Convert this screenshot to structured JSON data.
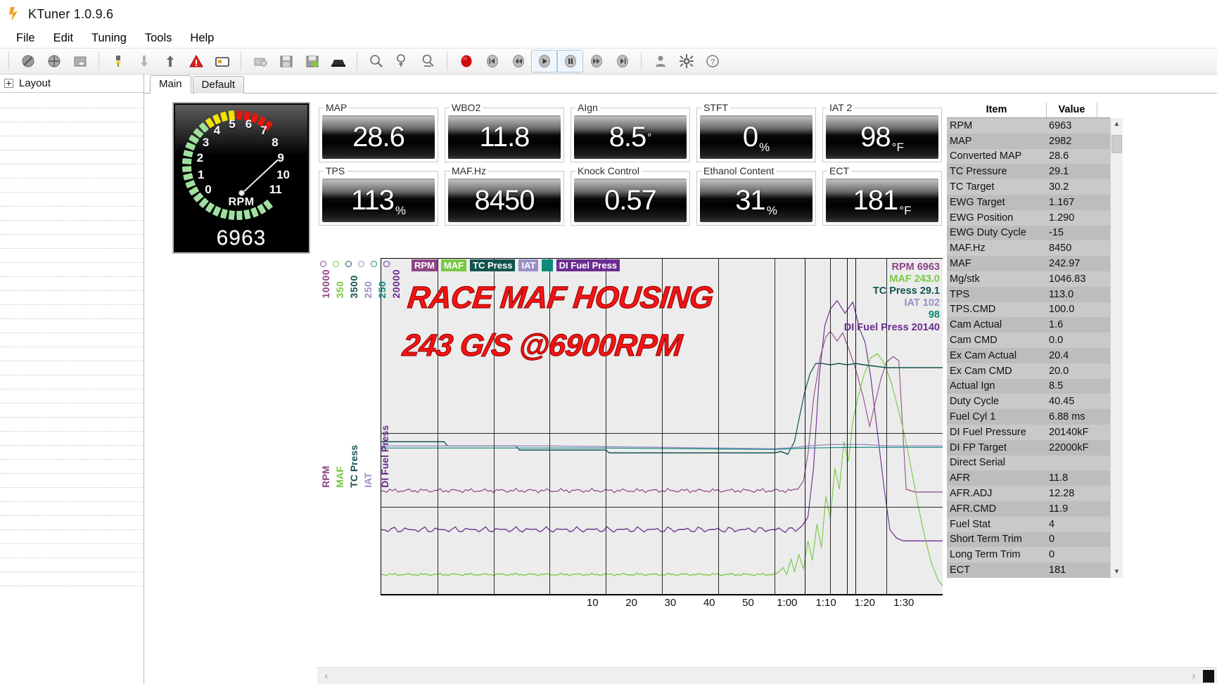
{
  "window": {
    "title": "KTuner 1.0.9.6",
    "logo_icon": "ktuner-logo-icon"
  },
  "menu": {
    "items": [
      "File",
      "Edit",
      "Tuning",
      "Tools",
      "Help"
    ]
  },
  "toolbar": {
    "groups": [
      {
        "buttons": [
          {
            "name": "disconnect-icon",
            "label": "Disconnect"
          },
          {
            "name": "connect-icon",
            "label": "Connect"
          },
          {
            "name": "open-folder-icon",
            "label": "Open"
          }
        ]
      },
      {
        "buttons": [
          {
            "name": "flash-ecu-icon",
            "label": "Flash"
          },
          {
            "name": "download-icon",
            "label": "Read"
          },
          {
            "name": "upload-icon",
            "label": "Write"
          },
          {
            "name": "dtc-warning-icon",
            "label": "Trouble Codes"
          },
          {
            "name": "monitor-icon",
            "label": "Monitor"
          }
        ]
      },
      {
        "buttons": [
          {
            "name": "datalog-icon",
            "label": "Datalog"
          },
          {
            "name": "save-icon",
            "label": "Save"
          },
          {
            "name": "save-as-icon",
            "label": "Save As"
          },
          {
            "name": "export-icon",
            "label": "Export"
          }
        ]
      },
      {
        "buttons": [
          {
            "name": "zoom-icon",
            "label": "Zoom"
          },
          {
            "name": "zoom-in-icon",
            "label": "Zoom In"
          },
          {
            "name": "zoom-out-icon",
            "label": "Zoom Out"
          }
        ]
      },
      {
        "buttons": [
          {
            "name": "record-icon",
            "label": "Record"
          },
          {
            "name": "skip-back-icon",
            "label": "Skip Back"
          },
          {
            "name": "rewind-icon",
            "label": "Rewind"
          },
          {
            "name": "play-icon",
            "label": "Play",
            "active": true
          },
          {
            "name": "pause-icon",
            "label": "Pause",
            "active": true
          },
          {
            "name": "fast-forward-icon",
            "label": "Fast Forward"
          },
          {
            "name": "skip-forward-icon",
            "label": "Skip Forward"
          }
        ]
      },
      {
        "buttons": [
          {
            "name": "user-icon",
            "label": "Account"
          },
          {
            "name": "gear-icon",
            "label": "Settings"
          },
          {
            "name": "help-icon",
            "label": "Help"
          }
        ]
      }
    ]
  },
  "left_panel": {
    "title": "Layout",
    "expander_icon": "plus-expander-icon",
    "row_count": 35
  },
  "tabs": [
    {
      "label": "Main",
      "selected": true
    },
    {
      "label": "Default",
      "selected": false
    }
  ],
  "tachometer": {
    "name": "rpm-tachometer",
    "unit_label": "RPM",
    "readout": "6963",
    "numbers": [
      "0",
      "1",
      "2",
      "3",
      "4",
      "5",
      "6",
      "7",
      "8",
      "9",
      "10",
      "11"
    ],
    "green_color": "#9fe09f",
    "yellow_color": "#f5e200",
    "red_color": "#e8150f"
  },
  "gauges": [
    {
      "label": "MAP",
      "value": "28.6",
      "unit": ""
    },
    {
      "label": "WBO2",
      "value": "11.8",
      "unit": ""
    },
    {
      "label": "AIgn",
      "value": "8.5",
      "unit": "°"
    },
    {
      "label": "STFT",
      "value": "0",
      "unit": "%"
    },
    {
      "label": "IAT 2",
      "value": "98",
      "unit": "°F"
    },
    {
      "label": "TPS",
      "value": "113",
      "unit": "%"
    },
    {
      "label": "MAF.Hz",
      "value": "8450",
      "unit": ""
    },
    {
      "label": "Knock Control",
      "value": "0.57",
      "unit": ""
    },
    {
      "label": "Ethanol Content",
      "value": "31",
      "unit": "%"
    },
    {
      "label": "ECT",
      "value": "181",
      "unit": "°F"
    }
  ],
  "chart_data": {
    "type": "line",
    "title": "",
    "xlabel": "",
    "annotation_text_line1": "RACE MAF HOUSING",
    "annotation_text_line2": "243 G/S @6900RPM",
    "annotation_color": "#f51313",
    "grid": true,
    "legend_position": "top",
    "x_tick_labels": [
      "10",
      "20",
      "30",
      "40",
      "50",
      "1:00",
      "1:10",
      "1:20",
      "1:30"
    ],
    "series": [
      {
        "name": "RPM",
        "color": "#8e4585",
        "axis_max": "10000",
        "current_value": "6963"
      },
      {
        "name": "MAF",
        "color": "#7ac943",
        "axis_max": "350",
        "current_value": "243.0"
      },
      {
        "name": "TC Press",
        "color": "#13534f",
        "axis_max": "3500",
        "current_value": "29.1"
      },
      {
        "name": "IAT",
        "color": "#9a8fc7",
        "axis_max": "250",
        "current_value": "102"
      },
      {
        "name": "",
        "color": "#0d8a7a",
        "axis_max": "250",
        "current_value": "98"
      },
      {
        "name": "DI Fuel Press",
        "color": "#6b2d8f",
        "axis_max": "20000",
        "current_value": "20140"
      }
    ]
  },
  "data_table": {
    "headers": {
      "item": "Item",
      "value": "Value"
    },
    "rows": [
      {
        "item": "RPM",
        "value": "6963"
      },
      {
        "item": "MAP",
        "value": "2982"
      },
      {
        "item": "Converted MAP",
        "value": "28.6"
      },
      {
        "item": "TC Pressure",
        "value": "29.1"
      },
      {
        "item": "TC Target",
        "value": "30.2"
      },
      {
        "item": "EWG Target",
        "value": "1.167"
      },
      {
        "item": "EWG Position",
        "value": "1.290"
      },
      {
        "item": "EWG Duty Cycle",
        "value": "-15"
      },
      {
        "item": "MAF.Hz",
        "value": "8450"
      },
      {
        "item": "MAF",
        "value": "242.97"
      },
      {
        "item": "Mg/stk",
        "value": "1046.83"
      },
      {
        "item": "TPS",
        "value": "113.0"
      },
      {
        "item": "TPS.CMD",
        "value": "100.0"
      },
      {
        "item": "Cam Actual",
        "value": "1.6"
      },
      {
        "item": "Cam CMD",
        "value": "0.0"
      },
      {
        "item": "Ex Cam Actual",
        "value": "20.4"
      },
      {
        "item": "Ex Cam CMD",
        "value": "20.0"
      },
      {
        "item": "Actual Ign",
        "value": "8.5"
      },
      {
        "item": "Duty Cycle",
        "value": "40.45"
      },
      {
        "item": "Fuel Cyl 1",
        "value": "6.88 ms"
      },
      {
        "item": "DI Fuel Pressure",
        "value": "20140kF"
      },
      {
        "item": "DI FP Target",
        "value": "22000kF"
      },
      {
        "item": "Direct Serial",
        "value": ""
      },
      {
        "item": "AFR",
        "value": "11.8"
      },
      {
        "item": "AFR.ADJ",
        "value": "12.28"
      },
      {
        "item": "AFR.CMD",
        "value": "11.9"
      },
      {
        "item": "Fuel Stat",
        "value": "4"
      },
      {
        "item": "Short Term Trim",
        "value": "0"
      },
      {
        "item": "Long Term Trim",
        "value": "0"
      },
      {
        "item": "ECT",
        "value": "181"
      }
    ],
    "scroll_up_icon": "chevron-up-icon",
    "scroll_down_icon": "chevron-down-icon"
  },
  "hscrollbar": {
    "left_arrow": "‹",
    "right_arrow": "›"
  }
}
